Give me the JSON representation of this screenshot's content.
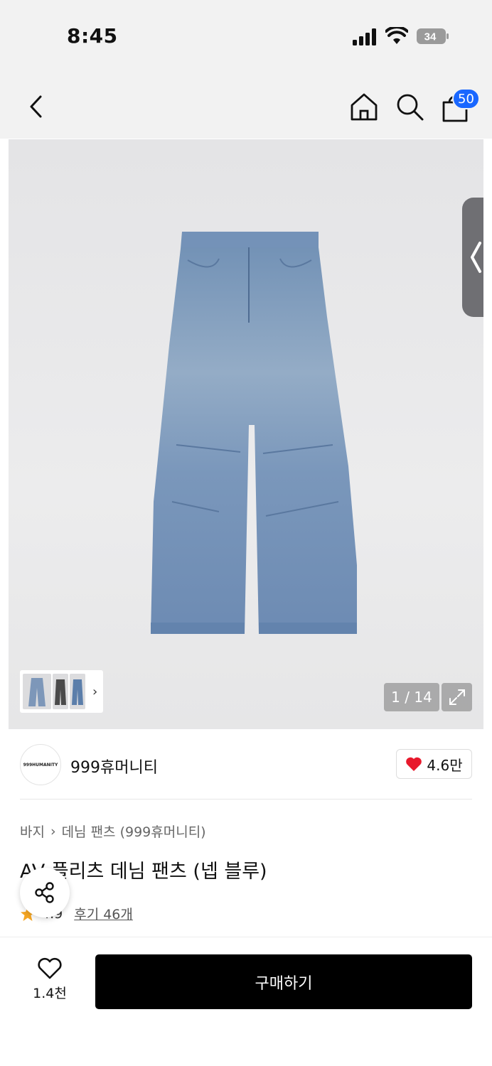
{
  "status": {
    "time": "8:45",
    "battery": "34"
  },
  "nav": {
    "cart_count": "50"
  },
  "gallery": {
    "counter": "1 / 14"
  },
  "brand": {
    "logo_text": "999HUMANITY",
    "name": "999휴머니티",
    "likes": "4.6만"
  },
  "breadcrumb": {
    "category": "바지",
    "subcategory": "데님 팬츠 (999휴머니티)"
  },
  "product": {
    "title": "AV 플리츠 데님 팬츠 (넵 블루)",
    "rating": "4.9",
    "reviews": "후기 46개"
  },
  "bottom": {
    "wish_count": "1.4천",
    "buy_label": "구매하기"
  },
  "colors": {
    "accent": "#1967ff",
    "heart": "#e8192c",
    "star": "#f5a623"
  }
}
